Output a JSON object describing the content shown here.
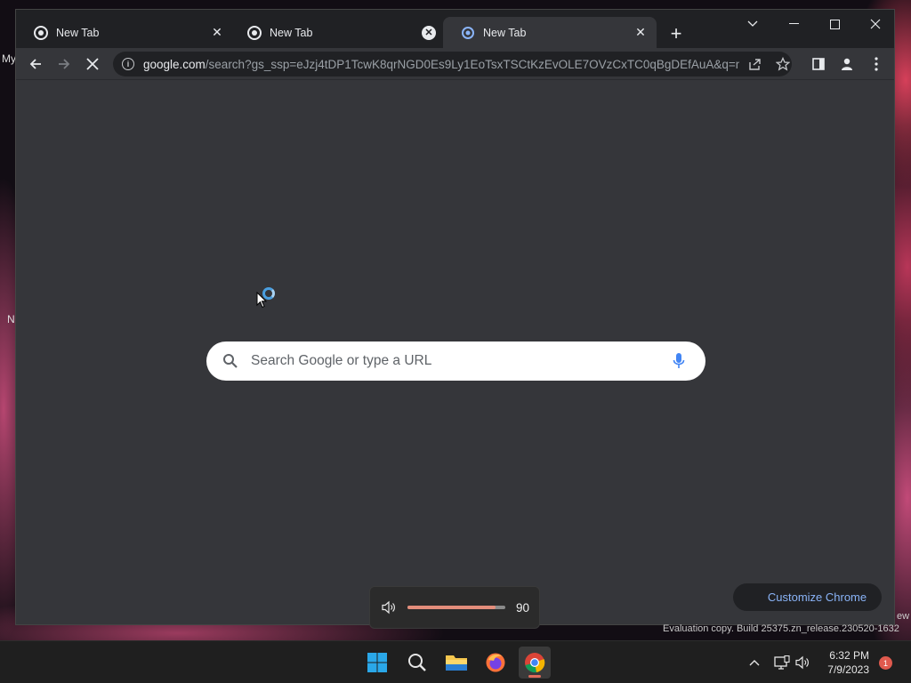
{
  "desktop": {
    "labels": [
      "My",
      "N",
      "ew"
    ]
  },
  "browser": {
    "tabs": [
      {
        "title": "New Tab",
        "active": false
      },
      {
        "title": "New Tab",
        "active": false
      },
      {
        "title": "New Tab",
        "active": true
      }
    ],
    "address_bar": {
      "host": "google.com",
      "path": "/search?gs_ssp=eJzj4tDP1TcwK8qrNGD0Es9Ly1EoTsxTSCtKzEvOLE7OVzCxTC0qBgDEfAuA&q=n..."
    }
  },
  "ntp": {
    "search_placeholder": "Search Google or type a URL",
    "customize_label": "Customize Chrome"
  },
  "volume_osd": {
    "value": "90",
    "level_percent": 90
  },
  "watermark": "Evaluation copy. Build 25375.zn_release.230520-1632",
  "taskbar": {
    "apps": [
      "start",
      "search",
      "file-explorer",
      "firefox",
      "chrome"
    ],
    "clock_time": "6:32 PM",
    "clock_date": "7/9/2023",
    "notification_count": "1"
  },
  "colors": {
    "accent_blue": "#8ab4f8",
    "volume_fill": "#e38d7b",
    "notification": "#e05a4e"
  }
}
